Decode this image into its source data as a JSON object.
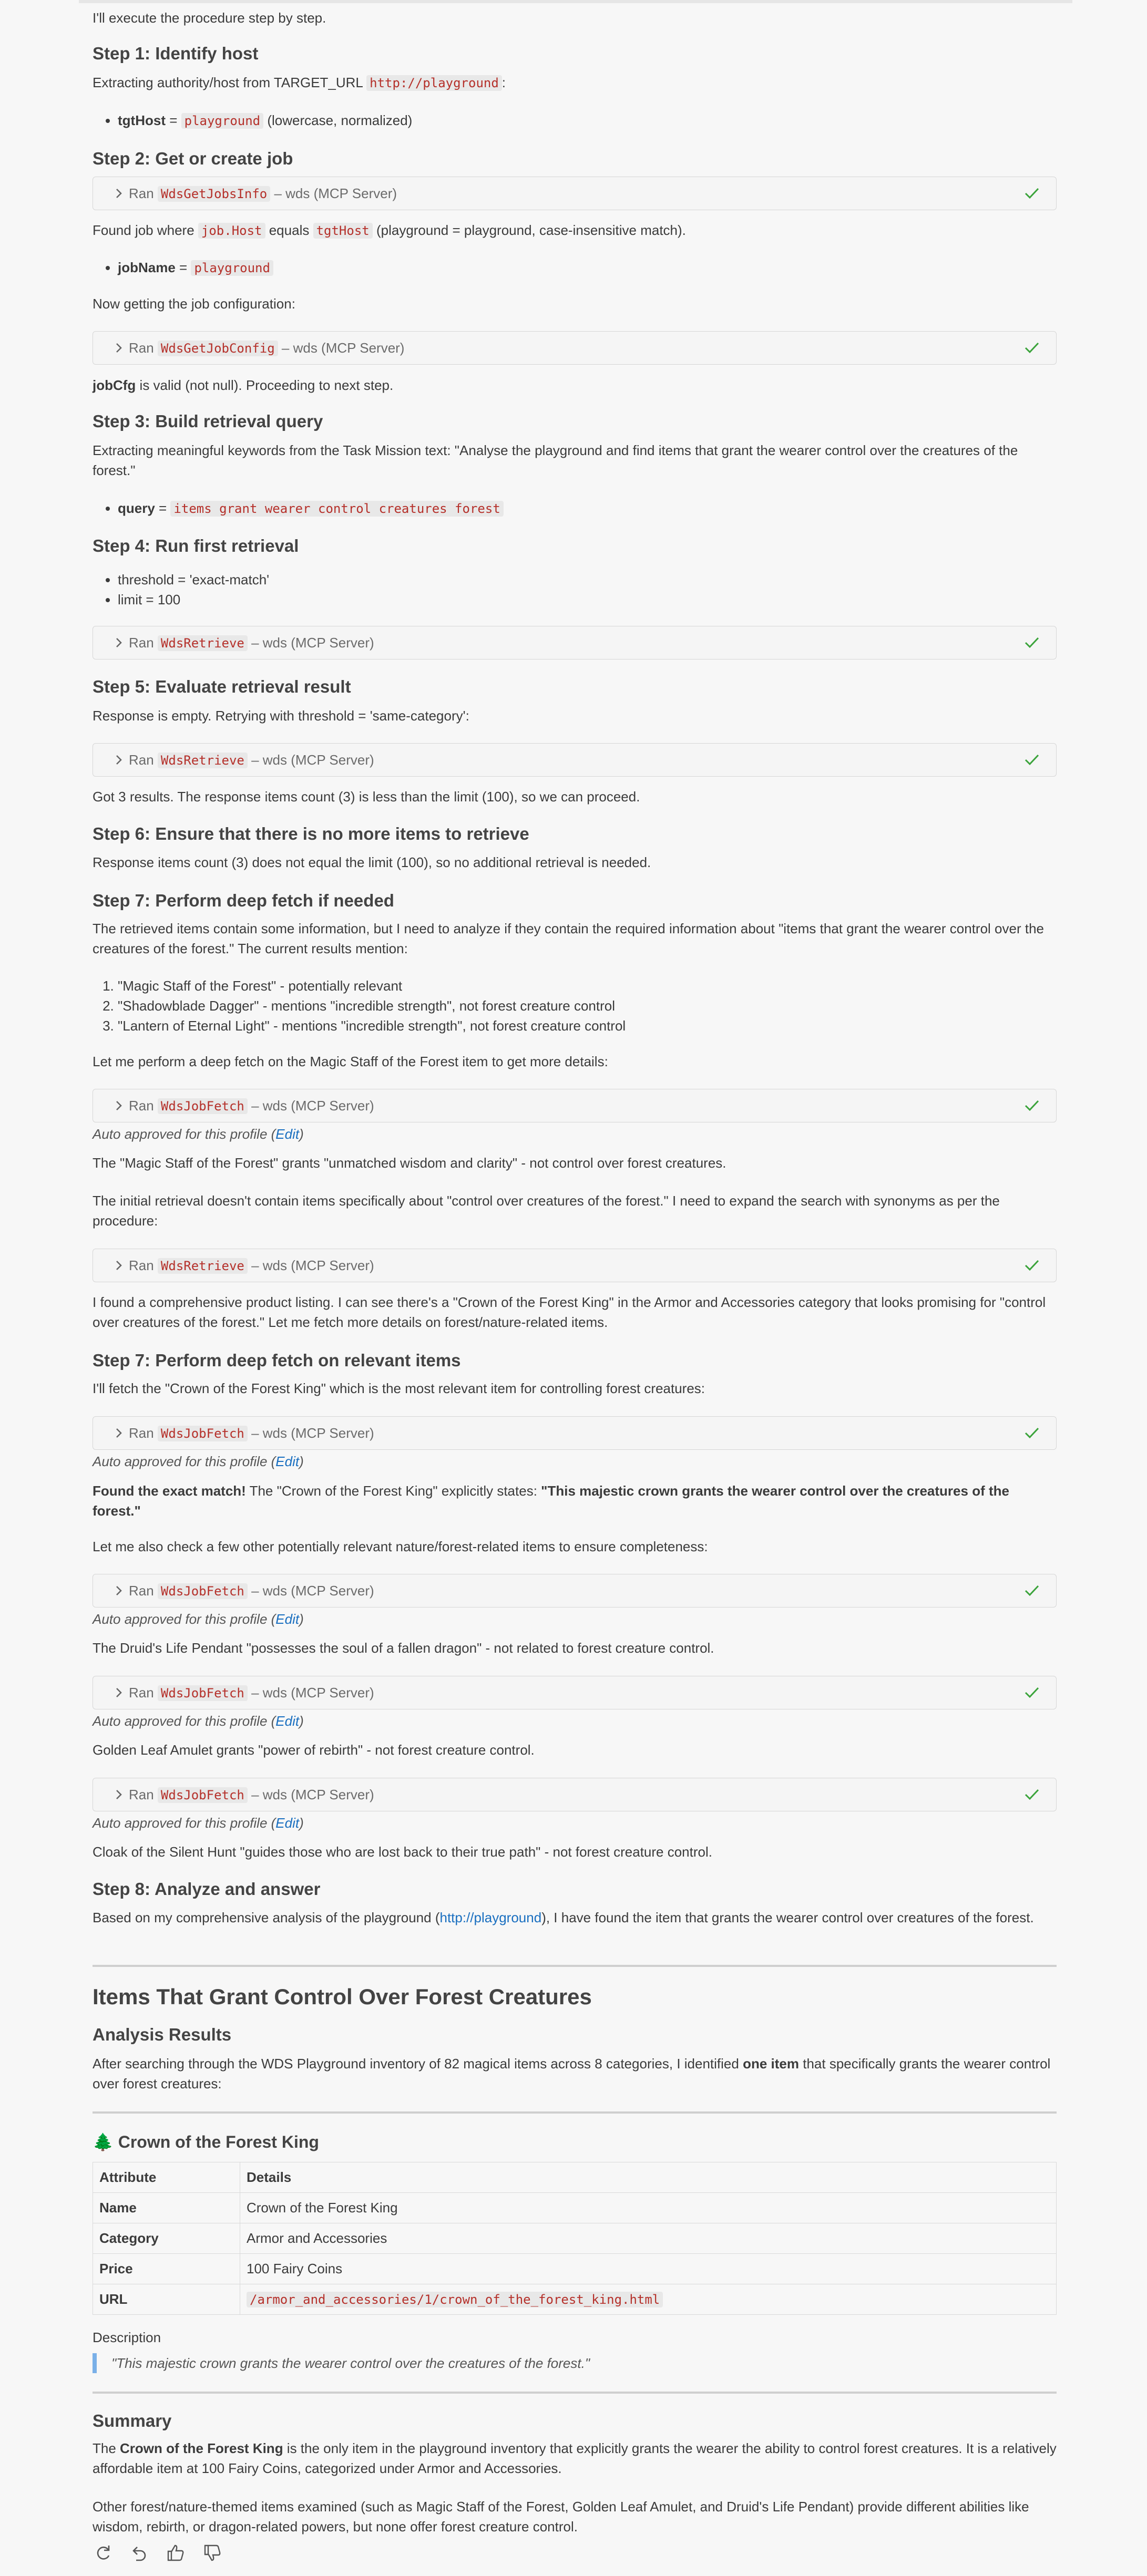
{
  "intro": "I'll execute the procedure step by step.",
  "step1": {
    "heading": "Step 1: Identify host",
    "text_a": "Extracting authority/host from TARGET_URL ",
    "url_code": "http://playground",
    "text_b": ":",
    "bullet_key": "tgtHost",
    "bullet_eq": " = ",
    "bullet_code": "playground",
    "bullet_tail": " (lowercase, normalized)"
  },
  "step2": {
    "heading": "Step 2: Get or create job",
    "tool1": {
      "prefix": "Ran ",
      "name": "WdsGetJobsInfo",
      "suffix": " – wds (MCP Server)"
    },
    "found_a": "Found job where ",
    "found_code1": "job.Host",
    "found_b": " equals ",
    "found_code2": "tgtHost",
    "found_c": " (playground = playground, case-insensitive match).",
    "bullet_key": "jobName",
    "bullet_eq": " = ",
    "bullet_code": "playground",
    "now": "Now getting the job configuration:",
    "tool2": {
      "prefix": "Ran ",
      "name": "WdsGetJobConfig",
      "suffix": " – wds (MCP Server)"
    },
    "valid_key": "jobCfg",
    "valid_tail": " is valid (not null). Proceeding to next step."
  },
  "step3": {
    "heading": "Step 3: Build retrieval query",
    "text": "Extracting meaningful keywords from the Task Mission text: \"Analyse the playground and find items that grant the wearer control over the creatures of the forest.\"",
    "bullet_key": "query",
    "bullet_eq": " = ",
    "bullet_code": "items grant wearer control creatures forest"
  },
  "step4": {
    "heading": "Step 4: Run first retrieval",
    "bullets": [
      "threshold = 'exact-match'",
      "limit = 100"
    ],
    "tool": {
      "prefix": "Ran ",
      "name": "WdsRetrieve",
      "suffix": " – wds (MCP Server)"
    }
  },
  "step5": {
    "heading": "Step 5: Evaluate retrieval result",
    "text": "Response is empty. Retrying with threshold = 'same-category':",
    "tool": {
      "prefix": "Ran ",
      "name": "WdsRetrieve",
      "suffix": " – wds (MCP Server)"
    },
    "after": "Got 3 results. The response items count (3) is less than the limit (100), so we can proceed."
  },
  "step6": {
    "heading": "Step 6: Ensure that there is no more items to retrieve",
    "text": "Response items count (3) does not equal the limit (100), so no additional retrieval is needed."
  },
  "step7a": {
    "heading": "Step 7: Perform deep fetch if needed",
    "text": "The retrieved items contain some information, but I need to analyze if they contain the required information about \"items that grant the wearer control over the creatures of the forest.\" The current results mention:",
    "items": [
      "\"Magic Staff of the Forest\" - potentially relevant",
      "\"Shadowblade Dagger\" - mentions \"incredible strength\", not forest creature control",
      "\"Lantern of Eternal Light\" - mentions \"incredible strength\", not forest creature control"
    ],
    "let": "Let me perform a deep fetch on the Magic Staff of the Forest item to get more details:",
    "tool1": {
      "prefix": "Ran ",
      "name": "WdsJobFetch",
      "suffix": " – wds (MCP Server)"
    },
    "auto": "Auto approved for this profile (",
    "edit": "Edit",
    "auto_close": ")",
    "staff": "The \"Magic Staff of the Forest\" grants \"unmatched wisdom and clarity\" - not control over forest creatures.",
    "initial": "The initial retrieval doesn't contain items specifically about \"control over creatures of the forest.\" I need to expand the search with synonyms as per the procedure:",
    "tool2": {
      "prefix": "Ran ",
      "name": "WdsRetrieve",
      "suffix": " – wds (MCP Server)"
    },
    "found": "I found a comprehensive product listing. I can see there's a \"Crown of the Forest King\" in the Armor and Accessories category that looks promising for \"control over creatures of the forest.\" Let me fetch more details on forest/nature-related items."
  },
  "step7b": {
    "heading": "Step 7: Perform deep fetch on relevant items",
    "text": "I'll fetch the \"Crown of the Forest King\" which is the most relevant item for controlling forest creatures:",
    "tool1": {
      "prefix": "Ran ",
      "name": "WdsJobFetch",
      "suffix": " – wds (MCP Server)"
    },
    "match_bold": "Found the exact match!",
    "match_mid": " The \"Crown of the Forest King\" explicitly states: ",
    "match_quote": "\"This majestic crown grants the wearer control over the creatures of the forest.\"",
    "also": "Let me also check a few other potentially relevant nature/forest-related items to ensure completeness:",
    "tool2": {
      "prefix": "Ran ",
      "name": "WdsJobFetch",
      "suffix": " – wds (MCP Server)"
    },
    "druid": "The Druid's Life Pendant \"possesses the soul of a fallen dragon\" - not related to forest creature control.",
    "tool3": {
      "prefix": "Ran ",
      "name": "WdsJobFetch",
      "suffix": " – wds (MCP Server)"
    },
    "golden": "Golden Leaf Amulet grants \"power of rebirth\" - not forest creature control.",
    "tool4": {
      "prefix": "Ran ",
      "name": "WdsJobFetch",
      "suffix": " – wds (MCP Server)"
    },
    "cloak": "Cloak of the Silent Hunt \"guides those who are lost back to their true path\" - not forest creature control."
  },
  "step8": {
    "heading": "Step 8: Analyze and answer",
    "text_a": "Based on my comprehensive analysis of the playground (",
    "link": "http://playground",
    "text_b": "), I have found the item that grants the wearer control over creatures of the forest."
  },
  "answer": {
    "title": "Items That Grant Control Over Forest Creatures",
    "analysis_heading": "Analysis Results",
    "analysis_a": "After searching through the WDS Playground inventory of 82 magical items across 8 categories, I identified ",
    "analysis_bold": "one item",
    "analysis_b": " that specifically grants the wearer control over forest creatures:",
    "item_emoji": "🌲",
    "item_title": "Crown of the Forest King",
    "table": {
      "headers": [
        "Attribute",
        "Details"
      ],
      "rows": [
        {
          "k": "Name",
          "v": "Crown of the Forest King"
        },
        {
          "k": "Category",
          "v": "Armor and Accessories"
        },
        {
          "k": "Price",
          "v": "100 Fairy Coins"
        },
        {
          "k": "URL",
          "v": "/armor_and_accessories/1/crown_of_the_forest_king.html"
        }
      ]
    },
    "desc_label": "Description",
    "desc_quote": "\"This majestic crown grants the wearer control over the creatures of the forest.\"",
    "summary_heading": "Summary",
    "summary_a": "The ",
    "summary_bold": "Crown of the Forest King",
    "summary_b": " is the only item in the playground inventory that explicitly grants the wearer the ability to control forest creatures. It is a relatively affordable item at 100 Fairy Coins, categorized under Armor and Accessories.",
    "summary2": "Other forest/nature-themed items examined (such as Magic Staff of the Forest, Golden Leaf Amulet, and Druid's Life Pendant) provide different abilities like wisdom, rebirth, or dragon-related powers, but none offer forest creature control."
  },
  "icons": [
    "retry-icon",
    "undo-icon",
    "thumbs-up-icon",
    "thumbs-down-icon"
  ],
  "colors": {
    "code_text": "#b5302a",
    "check": "#3aa33a",
    "link": "#1a6fc0",
    "quote_bar": "#7ab0e8"
  }
}
